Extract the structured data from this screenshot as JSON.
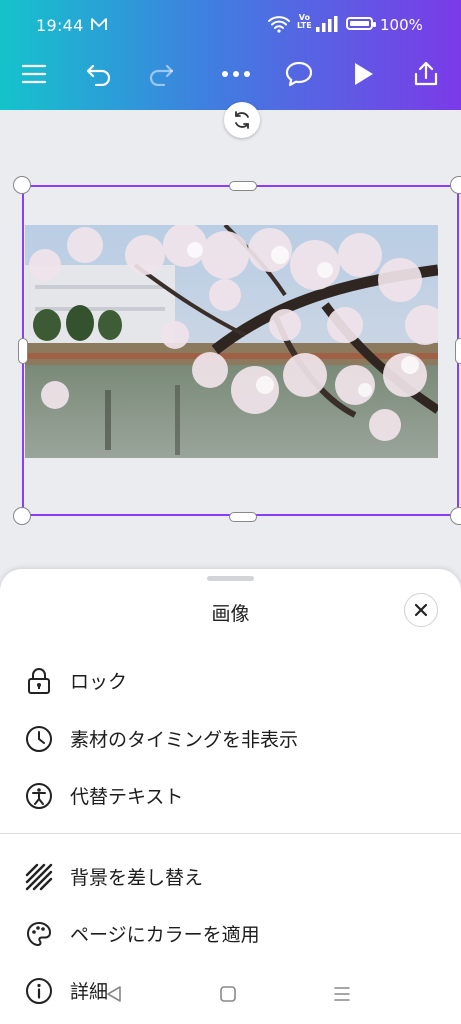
{
  "status_bar": {
    "time": "19:44",
    "battery": "100%",
    "network": "Vo LTE"
  },
  "toolbar": {
    "menu_icon": "hamburger-icon",
    "undo_icon": "undo-icon",
    "redo_icon": "redo-icon",
    "more_icon": "more-icon",
    "comment_icon": "comment-icon",
    "play_icon": "play-icon",
    "share_icon": "share-icon"
  },
  "canvas": {
    "selection_color": "#8b3dff",
    "image_subject": "cherry blossoms over pond"
  },
  "sheet": {
    "title": "画像",
    "items": [
      {
        "label": "ロック",
        "icon": "lock-icon"
      },
      {
        "label": "素材のタイミングを非表示",
        "icon": "clock-icon"
      },
      {
        "label": "代替テキスト",
        "icon": "accessibility-icon"
      },
      {
        "label": "背景を差し替え",
        "icon": "hatch-icon"
      },
      {
        "label": "ページにカラーを適用",
        "icon": "palette-icon"
      },
      {
        "label": "詳細",
        "icon": "info-icon"
      }
    ]
  },
  "nav": {
    "back_icon": "back-icon",
    "home_icon": "home-icon",
    "recents_icon": "recents-icon"
  },
  "colors": {
    "accent": "#8b3dff",
    "gradient_start": "#14c3cc",
    "gradient_end": "#7b3ae8"
  }
}
